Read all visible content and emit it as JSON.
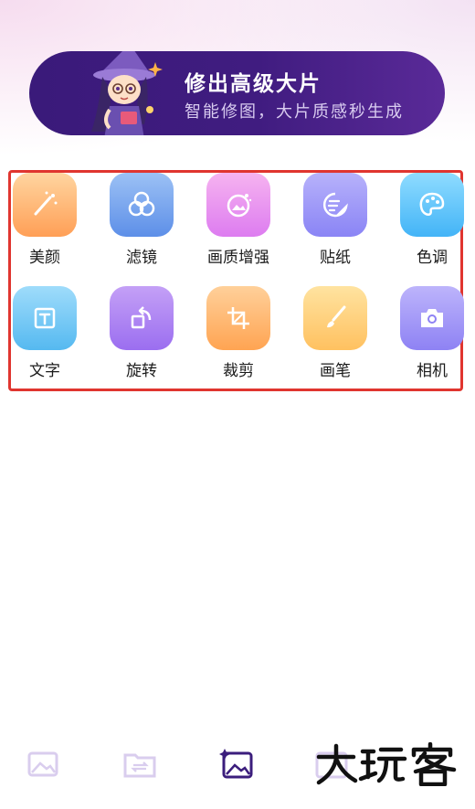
{
  "banner": {
    "title": "修出高级大片",
    "subtitle": "智能修图，大片质感秒生成"
  },
  "tools": [
    {
      "label": "美颜",
      "icon": "magic-wand-icon",
      "gradient": [
        "#ffd5a0",
        "#ff9f56"
      ]
    },
    {
      "label": "滤镜",
      "icon": "filter-circles-icon",
      "gradient": [
        "#9cc1f5",
        "#5d8fe8"
      ]
    },
    {
      "label": "画质增强",
      "icon": "enhance-image-icon",
      "gradient": [
        "#f6b3f0",
        "#dd7cf0"
      ]
    },
    {
      "label": "贴纸",
      "icon": "sticker-icon",
      "gradient": [
        "#b7b2fb",
        "#8a84f5"
      ]
    },
    {
      "label": "色调",
      "icon": "palette-icon",
      "gradient": [
        "#8fdcff",
        "#43b4f7"
      ]
    },
    {
      "label": "文字",
      "icon": "text-icon",
      "gradient": [
        "#9fdcfb",
        "#55b9f0"
      ]
    },
    {
      "label": "旋转",
      "icon": "rotate-icon",
      "gradient": [
        "#c4a0f6",
        "#9b6ef0"
      ]
    },
    {
      "label": "裁剪",
      "icon": "crop-icon",
      "gradient": [
        "#ffd09a",
        "#ffa452"
      ]
    },
    {
      "label": "画笔",
      "icon": "brush-icon",
      "gradient": [
        "#ffe3a0",
        "#ffc160"
      ]
    },
    {
      "label": "相机",
      "icon": "camera-icon",
      "gradient": [
        "#bdb4fb",
        "#8e82f4"
      ]
    }
  ],
  "bottom_nav": [
    {
      "icon": "gallery-icon",
      "color": "#d9cdee"
    },
    {
      "icon": "folder-transfer-icon",
      "color": "#d9cdee"
    },
    {
      "icon": "edit-image-icon",
      "color": "#3b1d7c"
    },
    {
      "icon": "frame-icon",
      "color": "#d9cdee"
    }
  ],
  "watermark": {
    "text": "大玩客"
  }
}
